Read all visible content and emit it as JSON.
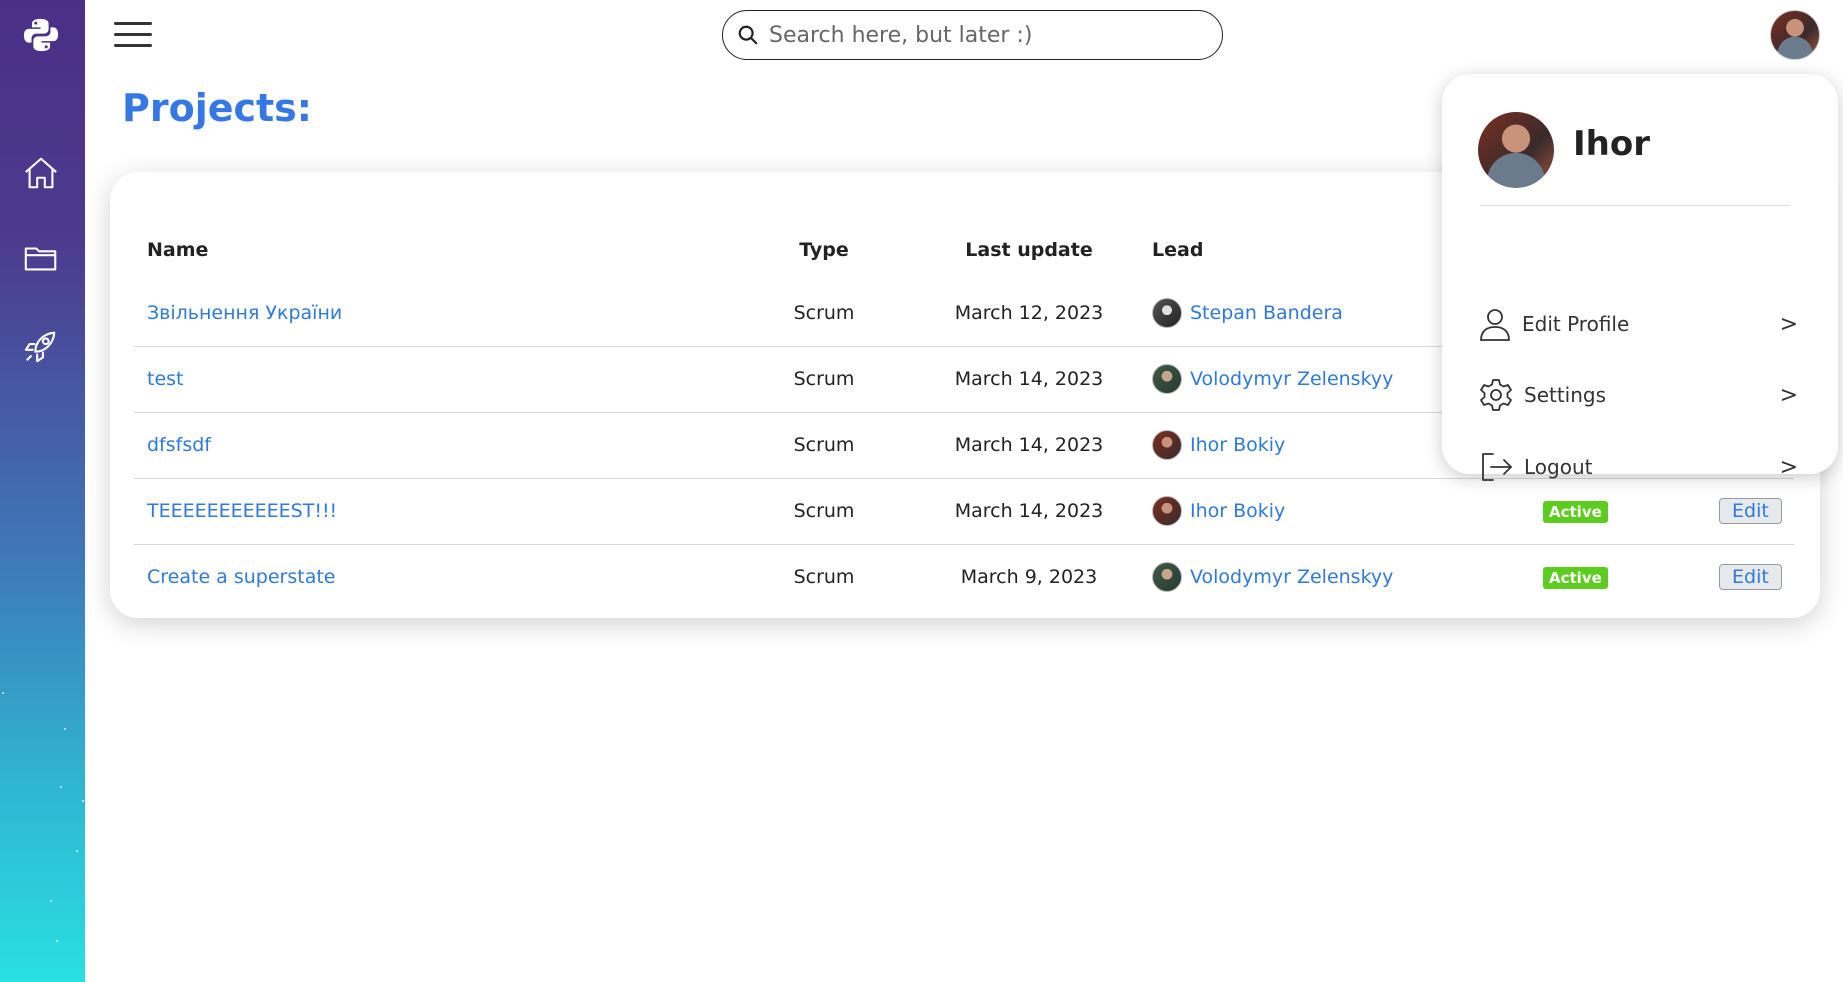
{
  "search": {
    "placeholder": "Search here, but later :)"
  },
  "page": {
    "title": "Projects:"
  },
  "sidebar": {
    "icons": [
      "python-logo-icon",
      "home-icon",
      "folder-icon",
      "rocket-icon"
    ]
  },
  "table": {
    "headers": {
      "name": "Name",
      "type": "Type",
      "last_update": "Last update",
      "lead": "Lead"
    },
    "rows": [
      {
        "name": "Звільнення України",
        "type": "Scrum",
        "last_update": "March 12, 2023",
        "lead": "Stepan Bandera",
        "status": "",
        "edit": ""
      },
      {
        "name": "test",
        "type": "Scrum",
        "last_update": "March 14, 2023",
        "lead": "Volodymyr Zelenskyy",
        "status": "",
        "edit": ""
      },
      {
        "name": "dfsfsdf",
        "type": "Scrum",
        "last_update": "March 14, 2023",
        "lead": "Ihor Bokiy",
        "status": "",
        "edit": ""
      },
      {
        "name": "TEEEEEEEEEEEST!!!",
        "type": "Scrum",
        "last_update": "March 14, 2023",
        "lead": "Ihor Bokiy",
        "status": "Active",
        "edit": "Edit"
      },
      {
        "name": "Create a superstate",
        "type": "Scrum",
        "last_update": "March 9, 2023",
        "lead": "Volodymyr Zelenskyy",
        "status": "Active",
        "edit": "Edit"
      }
    ]
  },
  "profile_menu": {
    "name": "Ihor",
    "items": [
      {
        "label": "Edit Profile",
        "arrow": ">"
      },
      {
        "label": "Settings",
        "arrow": ">"
      },
      {
        "label": "Logout",
        "arrow": ">"
      }
    ]
  },
  "colors": {
    "accent": "#3578e5",
    "link": "#2f7ad8",
    "active_badge": "#5ccc1e"
  }
}
